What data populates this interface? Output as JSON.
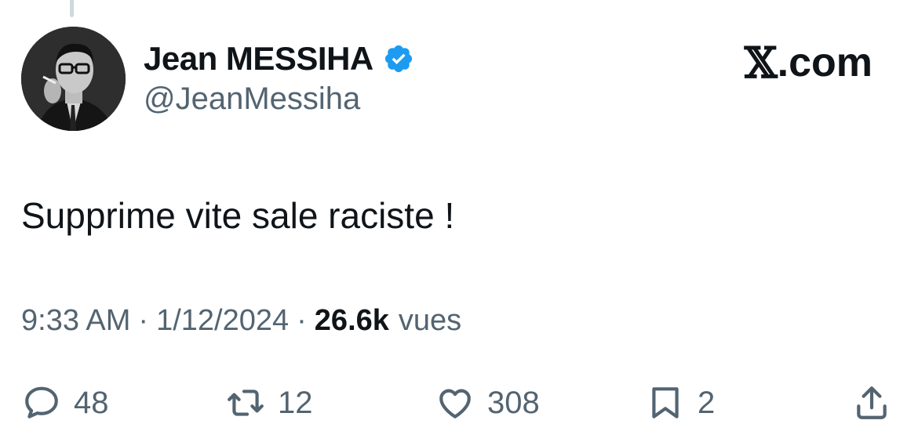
{
  "tweet": {
    "author": {
      "display_name": "Jean MESSIHA",
      "handle": "@JeanMessiha",
      "verified": true
    },
    "brand": {
      "x_glyph": "𝕏",
      "domain": ".com"
    },
    "text": "Supprime vite sale raciste !",
    "meta": {
      "time": "9:33 AM",
      "date": "1/12/2024",
      "views_count": "26.6k",
      "views_label": "vues",
      "separator": "·"
    },
    "actions": {
      "replies": "48",
      "reposts": "12",
      "likes": "308",
      "bookmarks": "2"
    },
    "colors": {
      "text": "#0f1419",
      "secondary": "#536471",
      "verified": "#1d9bf0",
      "background": "#ffffff"
    },
    "icons": [
      "verified-badge-icon",
      "reply-icon",
      "repost-icon",
      "like-icon",
      "bookmark-icon",
      "share-icon"
    ]
  }
}
